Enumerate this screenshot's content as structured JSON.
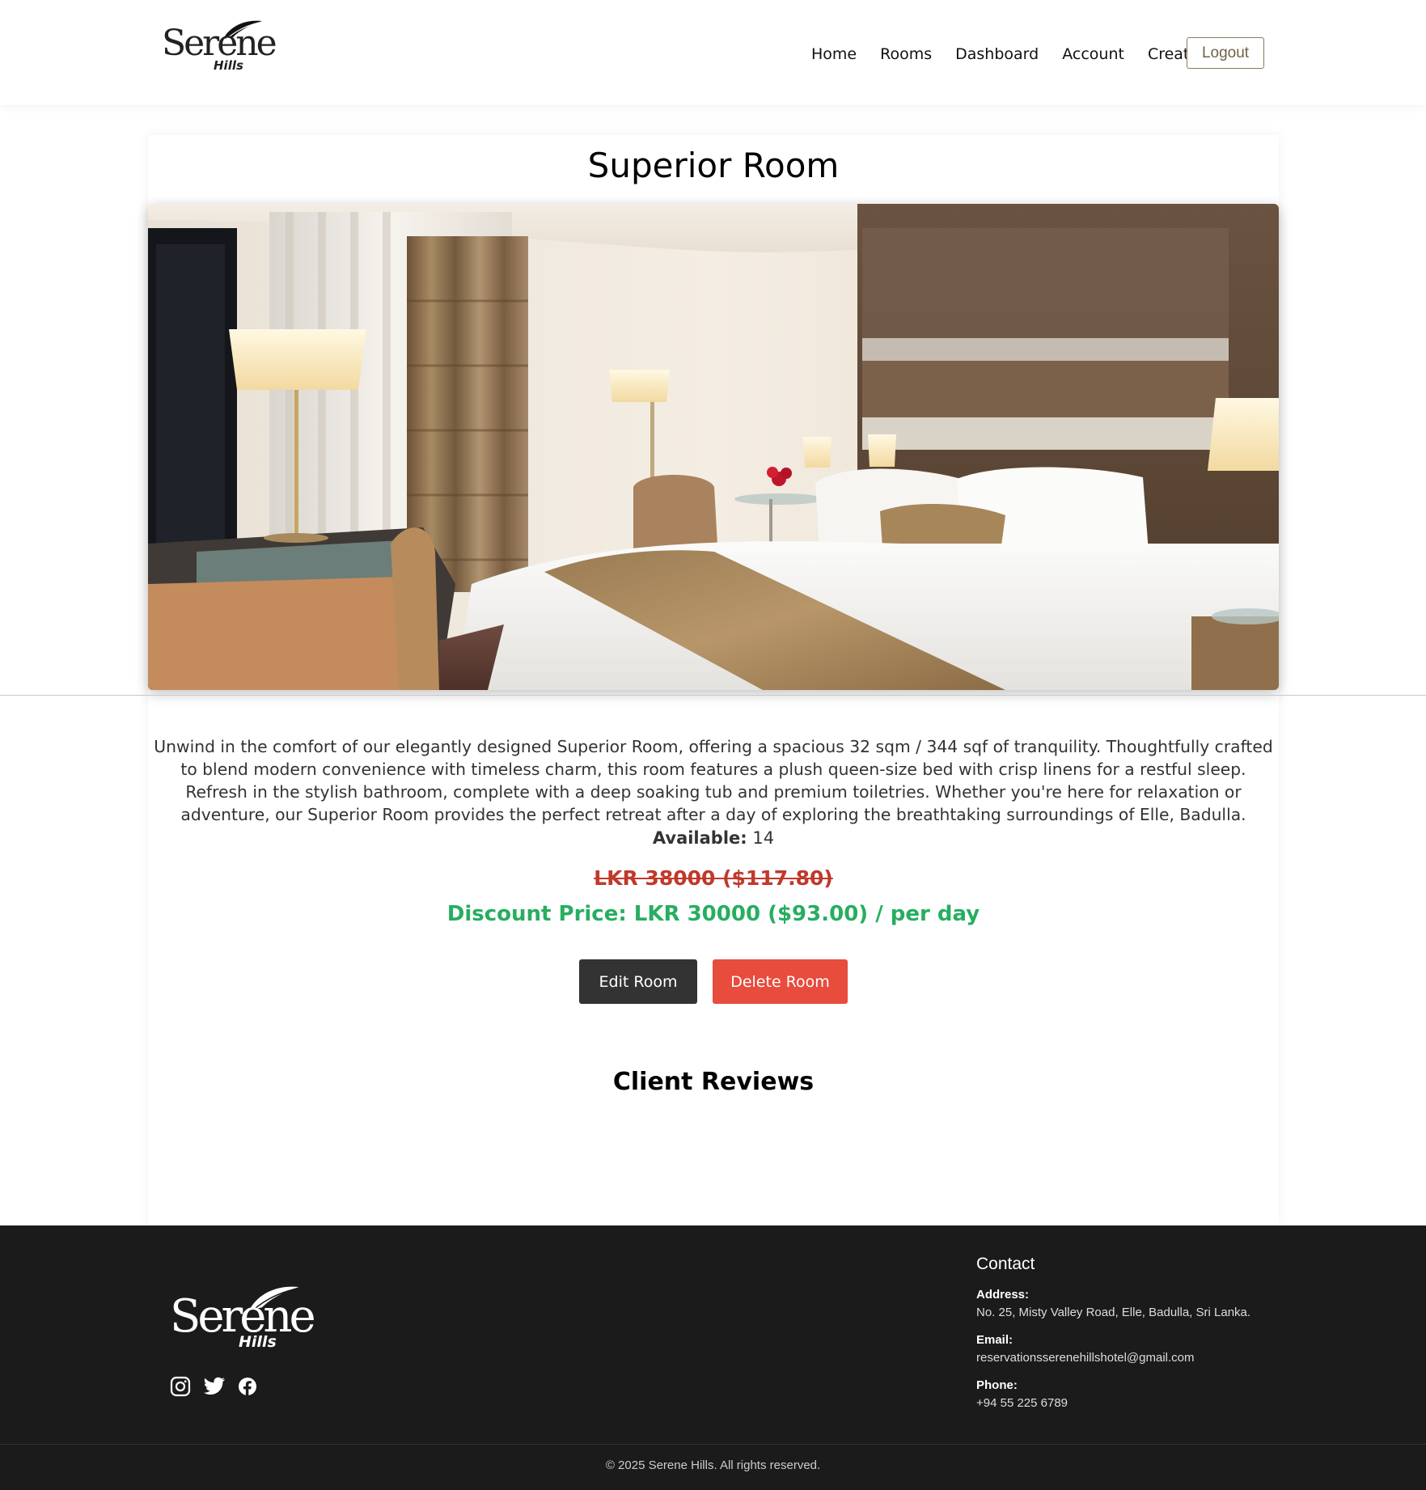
{
  "header": {
    "logo": {
      "word": "Serene",
      "sub": "Hills"
    },
    "nav": [
      {
        "label": "Home"
      },
      {
        "label": "Rooms"
      },
      {
        "label": "Dashboard"
      },
      {
        "label": "Account"
      },
      {
        "label": "Create"
      }
    ],
    "logout_label": "Logout"
  },
  "room": {
    "title": "Superior Room",
    "image_alt": "Superior Room photo",
    "description": "Unwind in the comfort of our elegantly designed Superior Room, offering a spacious 32 sqm / 344 sqf of tranquility. Thoughtfully crafted to blend modern convenience with timeless charm, this room features a plush queen-size bed with crisp linens for a restful sleep. Refresh in the stylish bathroom, complete with a deep soaking tub and premium toiletries. Whether you're here for relaxation or adventure, our Superior Room provides the perfect retreat after a day of exploring the breathtaking surroundings of Elle, Badulla.",
    "available_label": "Available:",
    "available_value": "14",
    "old_price": "LKR 38000 ($117.80)",
    "discount_price": "Discount Price: LKR 30000 ($93.00) / per day",
    "edit_label": "Edit Room",
    "delete_label": "Delete Room",
    "reviews_title": "Client Reviews"
  },
  "footer": {
    "logo": {
      "word": "Serene",
      "sub": "Hills"
    },
    "social": [
      "instagram-icon",
      "twitter-icon",
      "facebook-icon"
    ],
    "contact": {
      "heading": "Contact",
      "address_label": "Address:",
      "address": "No. 25, Misty Valley Road, Elle, Badulla, Sri Lanka.",
      "email_label": "Email:",
      "email": "reservationsserenehillshotel@gmail.com",
      "phone_label": "Phone:",
      "phone": "+94 55 225 6789"
    },
    "copyright": "© 2025 Serene Hills. All rights reserved."
  },
  "colors": {
    "old_price": "#c0392b",
    "discount_price": "#27ae60",
    "edit_button": "#333333",
    "delete_button": "#e74c3c",
    "footer_bg": "#1b1b1b",
    "logout_border": "#8b7a5c"
  }
}
